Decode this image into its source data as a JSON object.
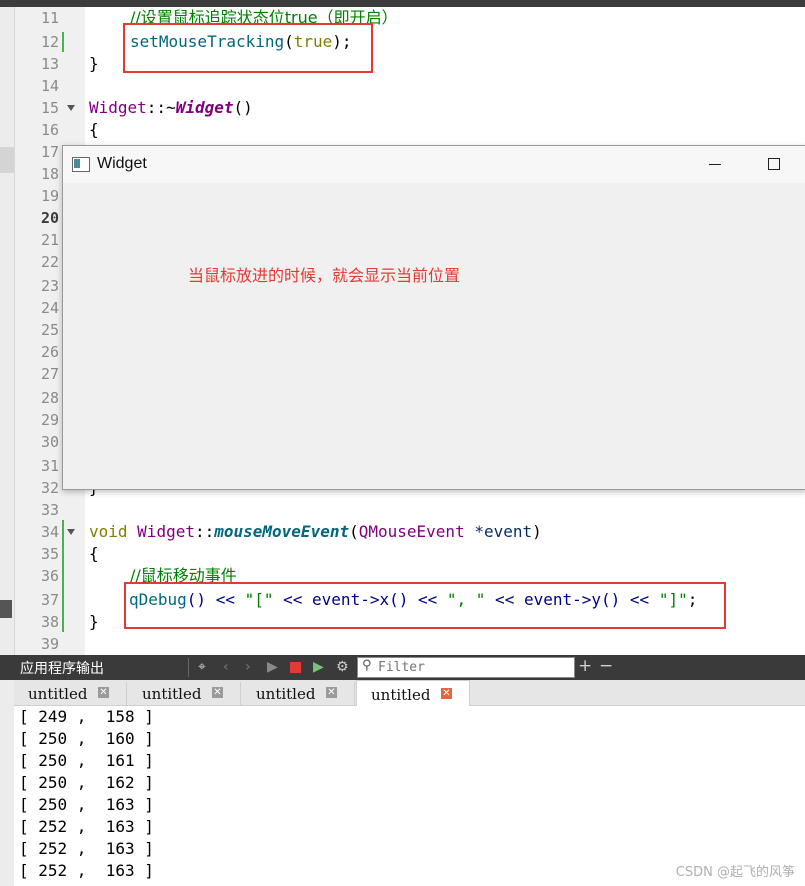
{
  "editor": {
    "lines": [
      {
        "num": "11",
        "comment": "//设置鼠标追踪状态位true（即开启）"
      },
      {
        "num": "12",
        "fn": "setMouseTracking",
        "open": "(",
        "kw": "true",
        "close": ");"
      },
      {
        "num": "13",
        "text": "}"
      },
      {
        "num": "14"
      },
      {
        "num": "15",
        "cls": "Widget",
        "sep": "::~",
        "fn": "Widget",
        "rest": "()"
      },
      {
        "num": "16",
        "text": "{"
      },
      {
        "num": "17"
      },
      {
        "num": "18"
      },
      {
        "num": "19"
      },
      {
        "num": "20"
      },
      {
        "num": "21"
      },
      {
        "num": "22"
      },
      {
        "num": "23"
      },
      {
        "num": "24"
      },
      {
        "num": "25"
      },
      {
        "num": "26"
      },
      {
        "num": "27"
      },
      {
        "num": "28"
      },
      {
        "num": "29"
      },
      {
        "num": "30"
      },
      {
        "num": "31"
      },
      {
        "num": "32",
        "text": "}"
      },
      {
        "num": "33"
      },
      {
        "num": "34",
        "kw": "void",
        "cls": "Widget",
        "sep": "::",
        "fn": "mouseMoveEvent",
        "open": "(",
        "type": "QMouseEvent",
        "param": "*event",
        "close": ")"
      },
      {
        "num": "35",
        "text": "{"
      },
      {
        "num": "36",
        "comment": "//鼠标移动事件"
      },
      {
        "num": "37",
        "a": "qDebug",
        "b": "() << ",
        "s1": "\"[\"",
        "c": " << event->x() << ",
        "s2": "\", \"",
        "d": " << event->y() << ",
        "s3": "\"]\"",
        "e": ";"
      },
      {
        "num": "38",
        "text": "}"
      },
      {
        "num": "39"
      }
    ]
  },
  "widget_window": {
    "title": "Widget",
    "message": "当鼠标放进的时候，就会显示当前位置"
  },
  "output_pane": {
    "title": "应用程序输出",
    "filter_placeholder": "Filter",
    "tabs": [
      "untitled",
      "untitled",
      "untitled",
      "untitled"
    ],
    "active_tab_index": 3,
    "lines": [
      "[ 249 ,  158 ]",
      "[ 250 ,  160 ]",
      "[ 250 ,  161 ]",
      "[ 250 ,  162 ]",
      "[ 250 ,  163 ]",
      "[ 252 ,  163 ]",
      "[ 252 ,  163 ]",
      "[ 252 ,  163 ]"
    ]
  },
  "watermark": "CSDN @起飞的风筝",
  "colors": {
    "highlight_box": "#e53935",
    "output_header": "#3a3a3a"
  }
}
